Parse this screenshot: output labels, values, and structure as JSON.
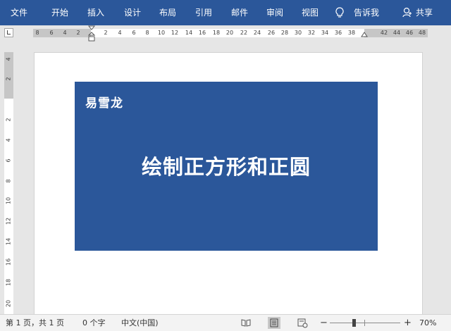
{
  "ribbon": {
    "tabs": [
      "文件",
      "开始",
      "插入",
      "设计",
      "布局",
      "引用",
      "邮件",
      "审阅",
      "视图"
    ],
    "tell_me": "告诉我",
    "share": "共享"
  },
  "hruler": {
    "labels": [
      "8",
      "6",
      "4",
      "2",
      "2",
      "4",
      "6",
      "8",
      "10",
      "12",
      "14",
      "16",
      "18",
      "20",
      "22",
      "24",
      "26",
      "28",
      "30",
      "32",
      "34",
      "36",
      "38",
      "42",
      "44",
      "46",
      "48"
    ]
  },
  "vruler": {
    "labels": [
      "4",
      "2",
      "2",
      "4",
      "6",
      "8",
      "10",
      "12",
      "14",
      "16",
      "18",
      "20"
    ]
  },
  "document": {
    "logo": "易雪龙",
    "headline": "绘制正方形和正圆",
    "banner_color": "#2b579a"
  },
  "statusbar": {
    "page_info": "第 1 页，共 1 页",
    "word_count": "0 个字",
    "language": "中文(中国)",
    "zoom_minus": "−",
    "zoom_plus": "+",
    "zoom_level": "70%"
  },
  "colors": {
    "ribbon": "#2b579a",
    "workspace": "#e6e6e6"
  }
}
